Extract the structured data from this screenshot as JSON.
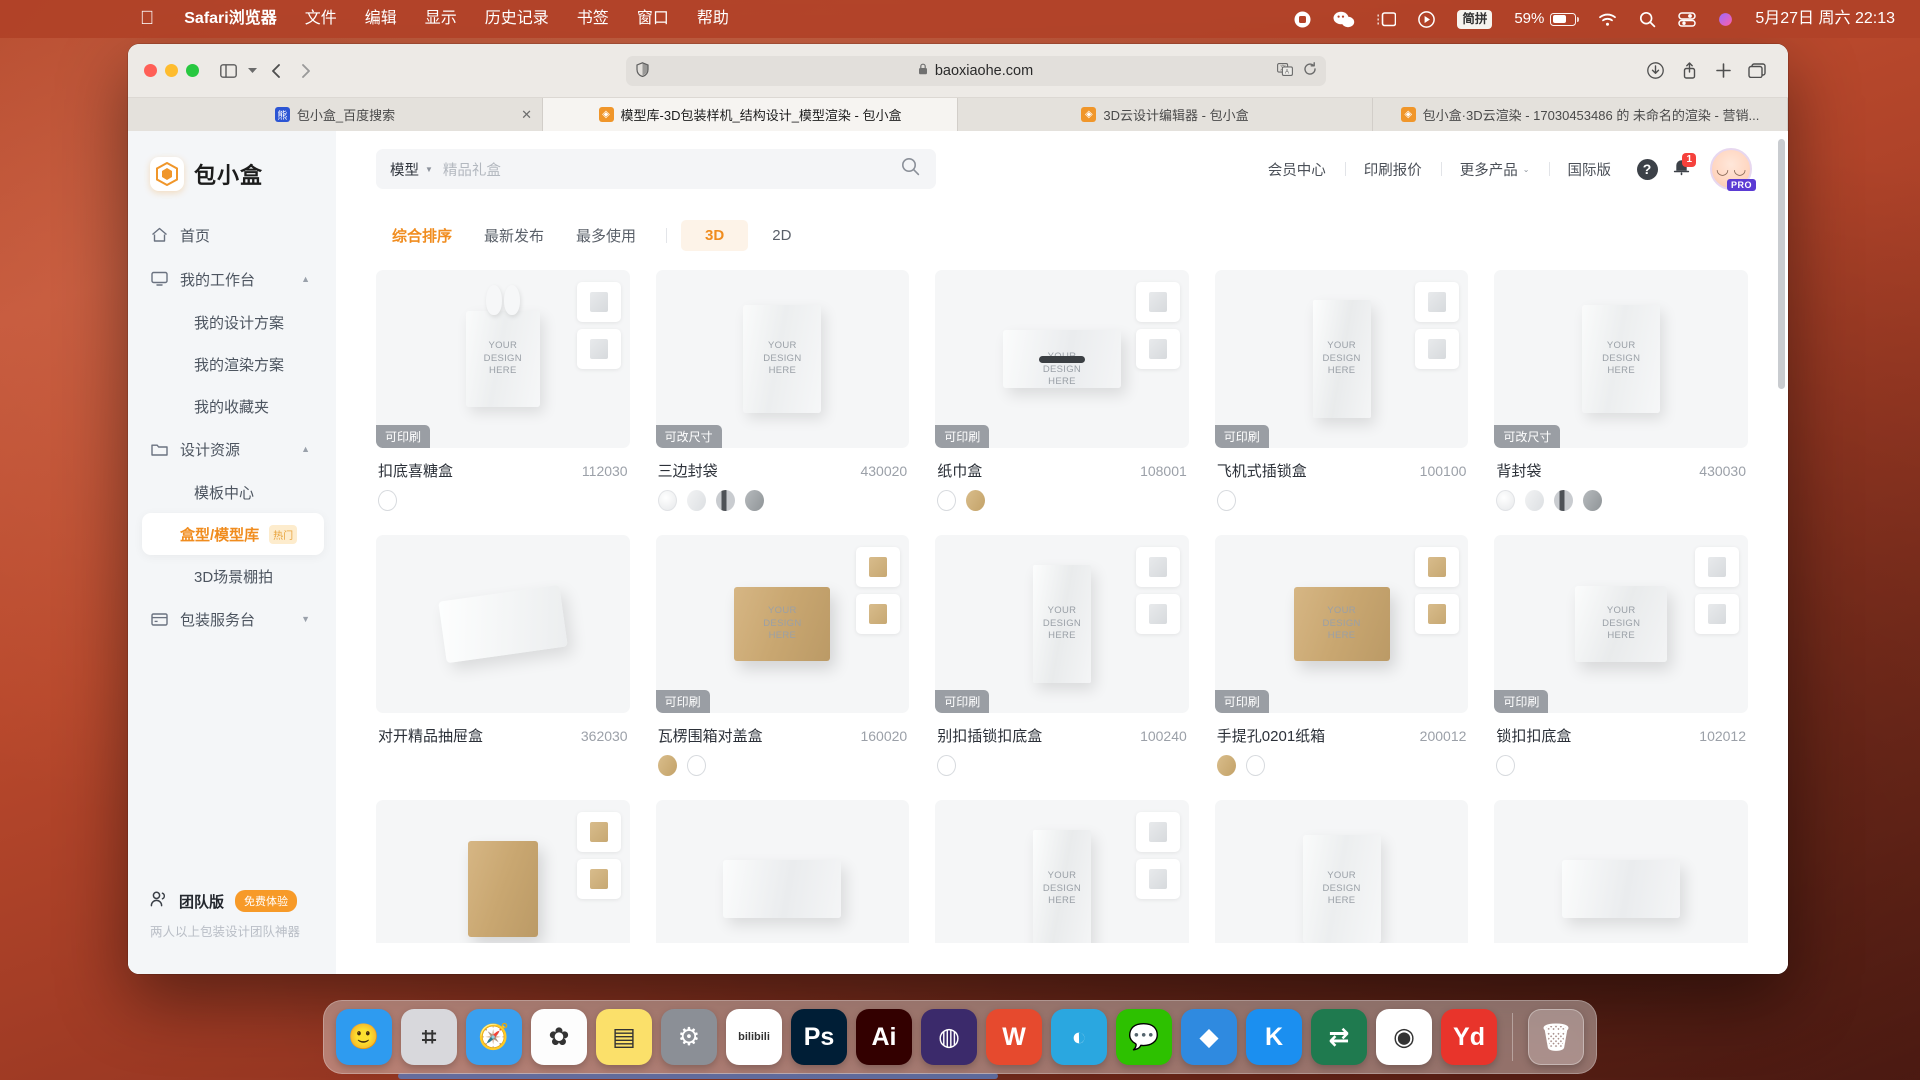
{
  "menubar": {
    "apple_icon": "apple-logo",
    "items": [
      "Safari浏览器",
      "文件",
      "编辑",
      "显示",
      "历史记录",
      "书签",
      "窗口",
      "帮助"
    ],
    "status": {
      "record_icon": "record-icon",
      "wechat_icon": "wechat-icon",
      "screen_icon": "screen-mirroring-icon",
      "control_icon": "playback-icon",
      "ime": "简拼",
      "battery_percent": "59%",
      "wifi_icon": "wifi-icon",
      "search_icon": "spotlight-icon",
      "control_center_icon": "control-center-icon",
      "siri_icon": "siri-icon",
      "datetime": "5月27日 周六 22:13"
    }
  },
  "safari": {
    "toolbar": {
      "sidebar_icon": "sidebar-toggle-icon",
      "sidebar_caret": "chevron-down-icon",
      "back_icon": "back-arrow-icon",
      "forward_icon": "forward-arrow-icon",
      "shield_icon": "privacy-shield-icon",
      "lock_icon": "lock-icon",
      "url": "baoxiaohe.com",
      "translate_icon": "translate-icon",
      "reload_icon": "reload-icon",
      "download_icon": "download-icon",
      "share_icon": "share-icon",
      "newtab_icon": "new-tab-icon",
      "tabs_icon": "tab-overview-icon"
    },
    "tabs": [
      {
        "title": "包小盒_百度搜索",
        "favicon": "baidu-favicon",
        "active": false,
        "closable": true
      },
      {
        "title": "模型库-3D包装样机_结构设计_模型渲染 - 包小盒",
        "favicon": "baoxiaohe-favicon",
        "active": true,
        "closable": false
      },
      {
        "title": "3D云设计编辑器 - 包小盒",
        "favicon": "baoxiaohe-favicon",
        "active": false,
        "closable": false
      },
      {
        "title": "包小盒·3D云渲染 - 17030453486 的 未命名的渲染 - 营销...",
        "favicon": "baoxiaohe-favicon",
        "active": false,
        "closable": false
      }
    ]
  },
  "sidebar": {
    "logo_text": "包小盒",
    "logo_icon": "box-logo-icon",
    "items": [
      {
        "label": "首页",
        "icon": "home-icon",
        "type": "top",
        "expandable": false
      },
      {
        "label": "我的工作台",
        "icon": "monitor-icon",
        "type": "top",
        "expandable": true,
        "caret": "▲"
      },
      {
        "label": "我的设计方案",
        "type": "sub"
      },
      {
        "label": "我的渲染方案",
        "type": "sub"
      },
      {
        "label": "我的收藏夹",
        "type": "sub"
      },
      {
        "label": "设计资源",
        "icon": "folder-icon",
        "type": "top",
        "expandable": true,
        "caret": "▲"
      },
      {
        "label": "模板中心",
        "type": "sub"
      },
      {
        "label": "盒型/模型库",
        "type": "sub",
        "active": true,
        "badge": "热门"
      },
      {
        "label": "3D场景棚拍",
        "type": "sub"
      },
      {
        "label": "包装服务台",
        "icon": "store-icon",
        "type": "top",
        "expandable": true,
        "caret": "▼"
      }
    ],
    "team": {
      "icon": "users-icon",
      "title": "团队版",
      "pill": "免费体验",
      "subtitle": "两人以上包装设计团队神器"
    }
  },
  "header": {
    "search": {
      "category": "模型",
      "category_caret": "▼",
      "value": "精品礼盒",
      "placeholder": "精品礼盒",
      "search_icon": "search-icon"
    },
    "nav": [
      {
        "label": "会员中心"
      },
      {
        "label": "印刷报价"
      },
      {
        "label": "更多产品",
        "caret": "⌄"
      },
      {
        "label": "国际版"
      }
    ],
    "help_icon": "help-icon",
    "bell_icon": "bell-icon",
    "bell_count": "1",
    "avatar_icon": "user-avatar",
    "pro_badge": "PRO"
  },
  "filters": {
    "sorts": [
      {
        "label": "综合排序",
        "active": true
      },
      {
        "label": "最新发布",
        "active": false
      },
      {
        "label": "最多使用",
        "active": false
      }
    ],
    "dims": [
      {
        "label": "3D",
        "active": true
      },
      {
        "label": "2D",
        "active": false
      }
    ]
  },
  "grid": {
    "design_label": "YOUR\nDESIGN\nHERE",
    "cards": [
      {
        "name": "扣底喜糖盒",
        "code": "112030",
        "badge": "可印刷",
        "swatches": [
          "white"
        ],
        "shape": "candy",
        "minis": 2,
        "mini_style": "white"
      },
      {
        "name": "三边封袋",
        "code": "430020",
        "badge": "可改尺寸",
        "swatches": [
          "pearl",
          "silver",
          "stripe",
          "grey"
        ],
        "shape": "pouch",
        "minis": 0,
        "mini_style": "white"
      },
      {
        "name": "纸巾盒",
        "code": "108001",
        "badge": "可印刷",
        "swatches": [
          "white",
          "kraft"
        ],
        "shape": "tissue",
        "minis": 2,
        "mini_style": "white"
      },
      {
        "name": "飞机式插锁盒",
        "code": "100100",
        "badge": "可印刷",
        "swatches": [
          "white"
        ],
        "shape": "tall",
        "minis": 2,
        "mini_style": "white"
      },
      {
        "name": "背封袋",
        "code": "430030",
        "badge": "可改尺寸",
        "swatches": [
          "pearl",
          "silver",
          "stripe",
          "grey"
        ],
        "shape": "pouch",
        "minis": 0,
        "mini_style": "white"
      },
      {
        "name": "对开精品抽屉盒",
        "code": "362030",
        "badge": "",
        "swatches": [],
        "shape": "drawer",
        "minis": 0,
        "mini_style": "white"
      },
      {
        "name": "瓦楞围箱对盖盒",
        "code": "160020",
        "badge": "可印刷",
        "swatches": [
          "kraft",
          "white"
        ],
        "shape": "carton",
        "minis": 2,
        "mini_style": "kraft"
      },
      {
        "name": "别扣插锁扣底盒",
        "code": "100240",
        "badge": "可印刷",
        "swatches": [
          "white"
        ],
        "shape": "tall",
        "minis": 2,
        "mini_style": "white"
      },
      {
        "name": "手提孔0201纸箱",
        "code": "200012",
        "badge": "可印刷",
        "swatches": [
          "kraft",
          "white"
        ],
        "shape": "carton",
        "minis": 2,
        "mini_style": "kraft"
      },
      {
        "name": "锁扣扣底盒",
        "code": "102012",
        "badge": "可印刷",
        "swatches": [
          "white"
        ],
        "shape": "wcarton",
        "minis": 2,
        "mini_style": "white"
      },
      {
        "name": "",
        "code": "",
        "badge": "",
        "swatches": [],
        "shape": "kraftbag",
        "minis": 2,
        "mini_style": "kraft"
      },
      {
        "name": "",
        "code": "",
        "badge": "",
        "swatches": [],
        "shape": "flatbox",
        "minis": 0,
        "mini_style": "white"
      },
      {
        "name": "",
        "code": "",
        "badge": "",
        "swatches": [],
        "shape": "tall",
        "minis": 2,
        "mini_style": "white"
      },
      {
        "name": "",
        "code": "",
        "badge": "",
        "swatches": [],
        "shape": "pouch2",
        "minis": 0,
        "mini_style": "white"
      },
      {
        "name": "",
        "code": "",
        "badge": "",
        "swatches": [],
        "shape": "flat",
        "minis": 0,
        "mini_style": "white"
      }
    ]
  },
  "dock": {
    "items": [
      {
        "name": "finder",
        "label": "🙂",
        "color": "#2e9bf0"
      },
      {
        "name": "launchpad",
        "label": "⌗",
        "color": "#d8d8dc"
      },
      {
        "name": "safari",
        "label": "🧭",
        "color": "#3aa0ef"
      },
      {
        "name": "photos",
        "label": "✿",
        "color": "#fdfdfd"
      },
      {
        "name": "notes",
        "label": "▤",
        "color": "#fbe06a"
      },
      {
        "name": "settings",
        "label": "⚙",
        "color": "#8b8f96"
      },
      {
        "name": "bilibili",
        "label": "bilibili",
        "color": "#ffffff"
      },
      {
        "name": "photoshop",
        "label": "Ps",
        "color": "#001e36"
      },
      {
        "name": "illustrator",
        "label": "Ai",
        "color": "#330000"
      },
      {
        "name": "firefox",
        "label": "◍",
        "color": "#3b2a6b"
      },
      {
        "name": "wps",
        "label": "W",
        "color": "#e64a2e"
      },
      {
        "name": "baoxiaohe",
        "label": "◐",
        "color": "#2aa7e0"
      },
      {
        "name": "wechat",
        "label": "💬",
        "color": "#2dc100"
      },
      {
        "name": "dingtalk",
        "label": "◆",
        "color": "#2f8ae0"
      },
      {
        "name": "kugou",
        "label": "K",
        "color": "#1b8ff0"
      },
      {
        "name": "sogou",
        "label": "⇄",
        "color": "#1f7a4f"
      },
      {
        "name": "chrome",
        "label": "◉",
        "color": "#ffffff"
      },
      {
        "name": "youdao",
        "label": "Yd",
        "color": "#e8342b"
      }
    ],
    "trash_icon": "trash-icon"
  }
}
